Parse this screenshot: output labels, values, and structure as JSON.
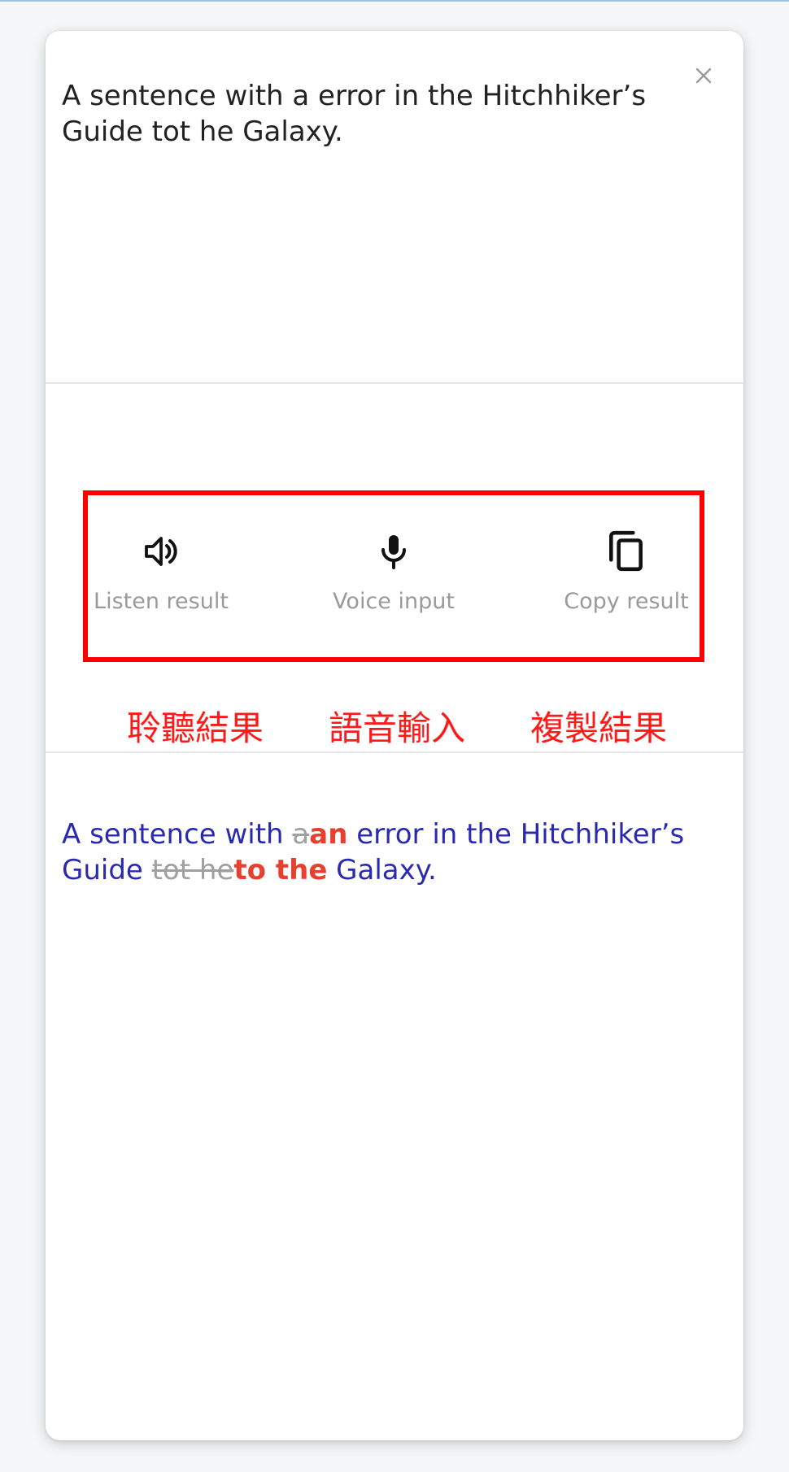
{
  "input": {
    "text": "A sentence with a error in the Hitchhiker’s Guide tot he Galaxy."
  },
  "actions": {
    "listen_label": "Listen result",
    "voice_label": "Voice input",
    "copy_label": "Copy result"
  },
  "captions": {
    "listen": "聆聽結果",
    "voice": "語音輸入",
    "copy": "複製結果"
  },
  "result": {
    "seg1": "A sentence with ",
    "del1": "a",
    "ins1": "an",
    "seg2": " error in the Hitchhiker’s Guide ",
    "del2": "tot he",
    "ins2": "to the",
    "seg3": " Galaxy."
  },
  "icons": {
    "close": "close-icon",
    "listen": "speaker-icon",
    "voice": "microphone-icon",
    "copy": "copy-icon"
  },
  "colors": {
    "result_text": "#2a2ab0",
    "insertion": "#e8402f",
    "deletion": "#a0a0a0",
    "annotation": "#ff0000"
  }
}
